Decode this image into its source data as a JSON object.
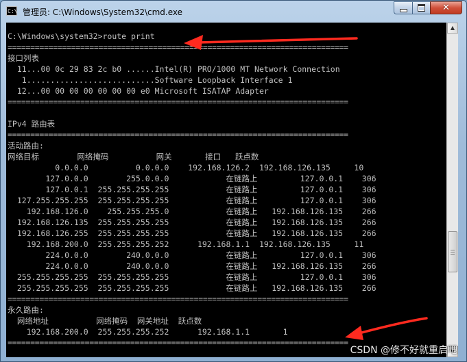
{
  "window": {
    "title": "管理员: C:\\Windows\\System32\\cmd.exe",
    "icon_text": "C:\\"
  },
  "controls": {
    "minimize": "minimize-icon",
    "maximize": "maximize-icon",
    "close_glyph": "✕"
  },
  "console": {
    "lines": [
      "C:\\Windows\\system32>route print",
      "===========================================================================",
      "接口列表",
      "  11...00 0c 29 83 2c b0 ......Intel(R) PRO/1000 MT Network Connection",
      "   1...........................Software Loopback Interface 1",
      "  12...00 00 00 00 00 00 00 e0 Microsoft ISATAP Adapter",
      "===========================================================================",
      "",
      "IPv4 路由表",
      "===========================================================================",
      "活动路由:",
      "网络目标        网络掩码          网关       接口   跃点数",
      "          0.0.0.0          0.0.0.0    192.168.126.2  192.168.126.135     10",
      "        127.0.0.0        255.0.0.0            在链路上         127.0.0.1    306",
      "        127.0.0.1  255.255.255.255            在链路上         127.0.0.1    306",
      "  127.255.255.255  255.255.255.255            在链路上         127.0.0.1    306",
      "    192.168.126.0    255.255.255.0            在链路上   192.168.126.135    266",
      "  192.168.126.135  255.255.255.255            在链路上   192.168.126.135    266",
      "  192.168.126.255  255.255.255.255            在链路上   192.168.126.135    266",
      "    192.168.200.0  255.255.255.252      192.168.1.1  192.168.126.135     11",
      "        224.0.0.0        240.0.0.0            在链路上         127.0.0.1    306",
      "        224.0.0.0        240.0.0.0            在链路上   192.168.126.135    266",
      "  255.255.255.255  255.255.255.255            在链路上         127.0.0.1    306",
      "  255.255.255.255  255.255.255.255            在链路上   192.168.126.135    266",
      "===========================================================================",
      "永久路由:",
      "  网络地址          网络掩码  网关地址  跃点数",
      "    192.168.200.0  255.255.255.252      192.168.1.1       1",
      "==========================================================================="
    ]
  },
  "annotations": {
    "arrow_color": "#ff2a1f"
  },
  "watermark": "CSDN @修不好就重启吧"
}
